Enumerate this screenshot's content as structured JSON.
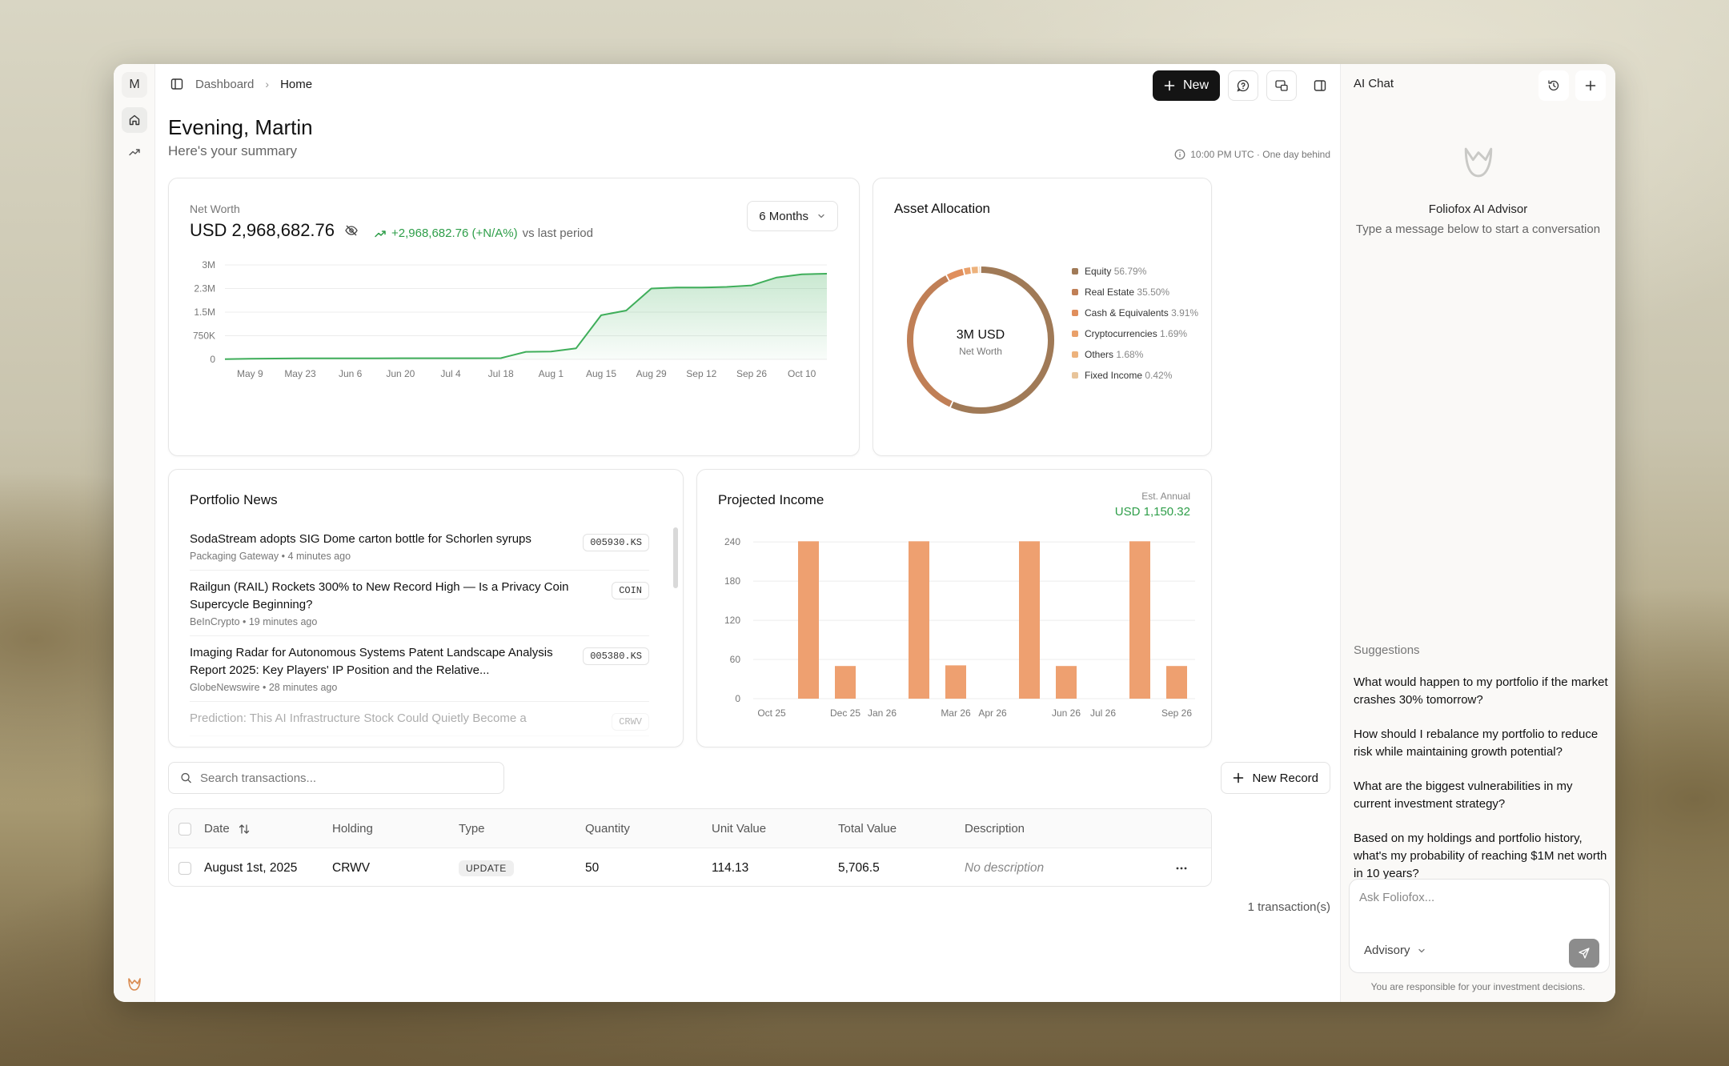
{
  "rail": {
    "avatar_initial": "M",
    "items": [
      {
        "icon": "home-icon",
        "active": true
      },
      {
        "icon": "trending-up-icon",
        "active": false
      }
    ]
  },
  "breadcrumb": {
    "parent": "Dashboard",
    "current": "Home"
  },
  "toolbar": {
    "new_label": "New"
  },
  "greeting": {
    "title": "Evening, Martin",
    "subtitle": "Here's your summary"
  },
  "sync_status": "10:00 PM UTC · One day behind",
  "net_worth": {
    "label": "Net Worth",
    "value": "USD 2,968,682.76",
    "change": "+2,968,682.76 (+N/A%)",
    "change_suffix": "vs last period",
    "range_label": "6 Months"
  },
  "asset_allocation": {
    "title": "Asset Allocation",
    "center_value": "3M USD",
    "center_label": "Net Worth",
    "items": [
      {
        "name": "Equity",
        "pct": "56.79%",
        "value": 56.79,
        "color": "#a07a57"
      },
      {
        "name": "Real Estate",
        "pct": "35.50%",
        "value": 35.5,
        "color": "#c07f56"
      },
      {
        "name": "Cash & Equivalents",
        "pct": "3.91%",
        "value": 3.91,
        "color": "#e08e5c"
      },
      {
        "name": "Cryptocurrencies",
        "pct": "1.69%",
        "value": 1.69,
        "color": "#e9a06a"
      },
      {
        "name": "Others",
        "pct": "1.68%",
        "value": 1.68,
        "color": "#edb27c"
      },
      {
        "name": "Fixed Income",
        "pct": "0.42%",
        "value": 0.42,
        "color": "#e8c49a"
      }
    ]
  },
  "news": {
    "title": "Portfolio News",
    "items": [
      {
        "headline": "SodaStream adopts SIG Dome carton bottle for Schorlen syrups",
        "source": "Packaging Gateway",
        "time": "4 minutes ago",
        "ticker": "005930.KS"
      },
      {
        "headline": "Railgun (RAIL) Rockets 300% to New Record High — Is a Privacy Coin Supercycle Beginning?",
        "source": "BeInCrypto",
        "time": "19 minutes ago",
        "ticker": "COIN"
      },
      {
        "headline": "Imaging Radar for Autonomous Systems Patent Landscape Analysis Report 2025: Key Players' IP Position and the Relative...",
        "source": "GlobeNewswire",
        "time": "28 minutes ago",
        "ticker": "005380.KS"
      },
      {
        "headline": "Prediction: This AI Infrastructure Stock Could Quietly Become a",
        "source": "",
        "time": "",
        "ticker": "CRWV"
      }
    ]
  },
  "projected_income": {
    "title": "Projected Income",
    "est_label": "Est. Annual",
    "est_value": "USD 1,150.32"
  },
  "transactions": {
    "search_placeholder": "Search transactions...",
    "new_record_label": "New Record",
    "columns": [
      "Date",
      "Holding",
      "Type",
      "Quantity",
      "Unit Value",
      "Total Value",
      "Description"
    ],
    "rows": [
      {
        "date": "August 1st, 2025",
        "holding": "CRWV",
        "type": "UPDATE",
        "quantity": "50",
        "unit_value": "114.13",
        "total_value": "5,706.5",
        "description": "No description"
      }
    ],
    "count_label": "1 transaction(s)"
  },
  "chat": {
    "title": "AI Chat",
    "empty_title": "Foliofox AI Advisor",
    "empty_subtitle": "Type a message below to start a conversation",
    "suggestions_label": "Suggestions",
    "suggestions": [
      "What would happen to my portfolio if the market crashes 30% tomorrow?",
      "How should I rebalance my portfolio to reduce risk while maintaining growth potential?",
      "What are the biggest vulnerabilities in my current investment strategy?",
      "Based on my holdings and portfolio history, what's my probability of reaching $1M net worth in 10 years?"
    ],
    "input_placeholder": "Ask Foliofox...",
    "mode_label": "Advisory",
    "disclaimer": "You are responsible for your investment decisions."
  },
  "colors": {
    "accent_green": "#2e9e49",
    "bar_orange": "#eea070",
    "primary_dark": "#141414"
  },
  "chart_data": [
    {
      "type": "line",
      "x": [
        "May 9",
        "May 23",
        "Jun 6",
        "Jun 20",
        "Jul 4",
        "Jul 18",
        "Aug 1",
        "Aug 15",
        "Aug 29",
        "Sep 12",
        "Sep 26",
        "Oct 10"
      ],
      "points": [
        {
          "x": "May 2",
          "y": 5000
        },
        {
          "x": "May 9",
          "y": 20000
        },
        {
          "x": "May 16",
          "y": 25000
        },
        {
          "x": "May 23",
          "y": 30000
        },
        {
          "x": "May 30",
          "y": 30000
        },
        {
          "x": "Jun 6",
          "y": 32000
        },
        {
          "x": "Jun 13",
          "y": 33000
        },
        {
          "x": "Jun 20",
          "y": 35000
        },
        {
          "x": "Jun 27",
          "y": 35000
        },
        {
          "x": "Jul 4",
          "y": 36000
        },
        {
          "x": "Jul 11",
          "y": 36000
        },
        {
          "x": "Jul 18",
          "y": 38000
        },
        {
          "x": "Jul 25",
          "y": 240000
        },
        {
          "x": "Aug 1",
          "y": 250000
        },
        {
          "x": "Aug 8",
          "y": 350000
        },
        {
          "x": "Aug 15",
          "y": 1400000
        },
        {
          "x": "Aug 22",
          "y": 1550000
        },
        {
          "x": "Aug 29",
          "y": 2250000
        },
        {
          "x": "Sep 5",
          "y": 2280000
        },
        {
          "x": "Sep 12",
          "y": 2280000
        },
        {
          "x": "Sep 19",
          "y": 2300000
        },
        {
          "x": "Sep 26",
          "y": 2350000
        },
        {
          "x": "Oct 3",
          "y": 2600000
        },
        {
          "x": "Oct 10",
          "y": 2700000
        },
        {
          "x": "Oct 17",
          "y": 2720000
        }
      ],
      "y_ticks": [
        "0",
        "750K",
        "1.5M",
        "2.3M",
        "3M"
      ],
      "y_tick_values": [
        0,
        750000,
        1500000,
        2250000,
        3000000
      ],
      "ylim": [
        0,
        3000000
      ],
      "grid": true,
      "color": "#3fae5a"
    },
    {
      "type": "pie",
      "donut": true,
      "labels": [
        "Equity",
        "Real Estate",
        "Cash & Equivalents",
        "Cryptocurrencies",
        "Others",
        "Fixed Income"
      ],
      "values": [
        56.79,
        35.5,
        3.91,
        1.69,
        1.68,
        0.42
      ]
    },
    {
      "type": "bar",
      "categories": [
        "Oct 25",
        "Nov 25",
        "Dec 25",
        "Jan 26",
        "Feb 26",
        "Mar 26",
        "Apr 26",
        "May 26",
        "Jun 26",
        "Jul 26",
        "Aug 26",
        "Sep 26"
      ],
      "x_tick_labels": [
        "Oct 25",
        "Dec 25",
        "Jan 26",
        "Mar 26",
        "Apr 26",
        "Jun 26",
        "Jul 26",
        "Sep 26"
      ],
      "values": [
        0,
        241,
        50,
        0,
        241,
        51,
        0,
        241,
        50,
        0,
        241,
        50
      ],
      "y_ticks": [
        "0",
        "60",
        "120",
        "180",
        "240"
      ],
      "y_tick_values": [
        0,
        60,
        120,
        180,
        240
      ],
      "ylim": [
        0,
        250
      ],
      "grid": true
    }
  ]
}
